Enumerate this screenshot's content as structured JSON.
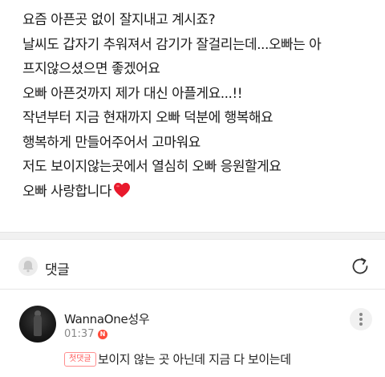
{
  "post": {
    "lines": [
      "요즘 아픈곳 없이 잘지내고 계시죠?",
      "날씨도 갑자기 추워져서 감기가 잘걸리는데...오빠는 아",
      "프지않으셨으면 좋겠어요",
      "오빠 아픈것까지 제가 대신 아플게요...!!",
      "작년부터 지금 현재까지 오빠 덕분에 행복해요",
      "행복하게 만들어주어서 고마워요",
      "저도 보이지않는곳에서 열심히 오빠 응원할게요",
      "오빠 사랑합니다"
    ],
    "heart_icon": "red-heart-emoji",
    "heart_color": "#e8192c"
  },
  "comments_section": {
    "title": "댓글",
    "bell_icon": "bell-icon",
    "refresh_icon": "refresh-icon"
  },
  "comment": {
    "author": "WannaOne성우",
    "time": "01:37",
    "new_badge": "N",
    "first_comment_badge": "첫댓글",
    "text": "보이지 않는 곳 아닌데 지금 다 보이는데",
    "more_icon": "more-vertical-icon"
  },
  "colors": {
    "accent_red": "#ff4b3a",
    "separator": "#f1f1f1"
  }
}
